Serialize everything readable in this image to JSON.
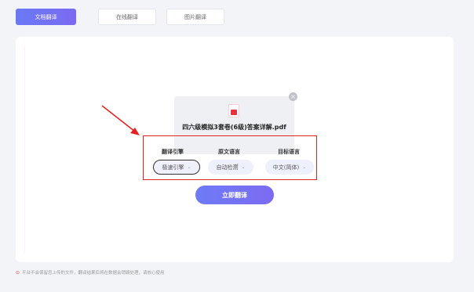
{
  "tabs": [
    {
      "label": "文档翻译",
      "active": true
    },
    {
      "label": "在线翻译",
      "active": false
    },
    {
      "label": "图片翻译",
      "active": false
    }
  ],
  "file": {
    "name": "四六级模拟3套卷(6级)答案详解.pdf",
    "icon": "pdf-file-icon"
  },
  "options": {
    "engine_label": "翻译引擎",
    "engine_value": "极速引擎",
    "source_label": "原文语言",
    "source_value": "自动检测",
    "target_label": "目标语言",
    "target_value": "中文(简体)",
    "swap_icon": "⇌"
  },
  "translate_button": "立即翻译",
  "notice": "平台不会保留您上传的文件，翻译结果后将在数据会销毁处理，请放心使用",
  "colors": {
    "accent": "#7170f4",
    "highlight": "#e3231f",
    "pdf_red": "#e5323f"
  }
}
